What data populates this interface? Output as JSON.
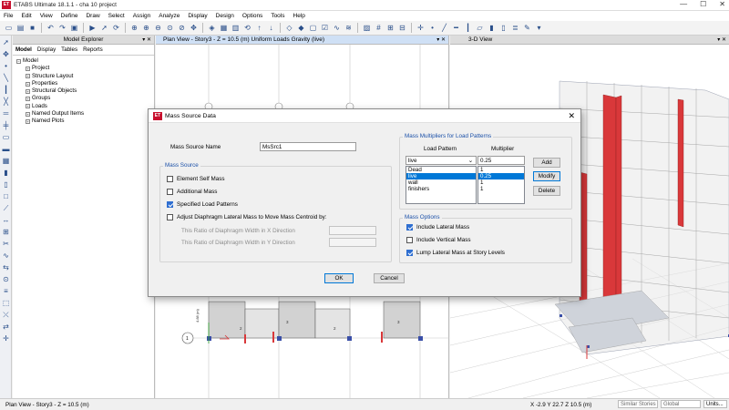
{
  "app": {
    "title": "ETABS Ultimate 18.1.1 - cha 10 project",
    "logo_text": "ET"
  },
  "window_controls": {
    "minimize": "—",
    "maximize": "☐",
    "close": "✕"
  },
  "menu": [
    "File",
    "Edit",
    "View",
    "Define",
    "Draw",
    "Select",
    "Assign",
    "Analyze",
    "Display",
    "Design",
    "Options",
    "Tools",
    "Help"
  ],
  "explorer": {
    "title": "Model Explorer",
    "tabs": [
      "Model",
      "Display",
      "Tables",
      "Reports"
    ],
    "root": "Model",
    "items": [
      "Project",
      "Structure Layout",
      "Properties",
      "Structural Objects",
      "Groups",
      "Loads",
      "Named Output Items",
      "Named Plots"
    ]
  },
  "plan_view": {
    "title": "Plan View - Story3 - Z = 10.5 (m)  Uniform Loads Gravity  (live)",
    "grid_number": "1",
    "dimension_label": "4.88 (m)",
    "area_labels": [
      "2",
      "3",
      "2",
      "3"
    ]
  },
  "view_3d": {
    "title": "3-D View"
  },
  "status": {
    "left": "Plan View - Story3 - Z = 10.5 (m)",
    "coords": "X -2.9  Y 22.7  Z 10.5 (m)",
    "stories": "Similar Stories",
    "coord_system": "Global",
    "units": "Units..."
  },
  "dialog": {
    "title": "Mass Source Data",
    "logo_text": "ET",
    "close": "✕",
    "mass_source_name_label": "Mass Source Name",
    "mass_source_name": "MsSrc1",
    "mass_source_group": "Mass Source",
    "element_self_mass": "Element Self Mass",
    "additional_mass": "Additional Mass",
    "specified_load_patterns": "Specified Load Patterns",
    "adjust_diaphragm": "Adjust Diaphragm Lateral Mass to Move Mass Centroid by:",
    "ratio_x": "This Ratio of Diaphragm Width in X Direction",
    "ratio_y": "This Ratio of Diaphragm Width in Y Direction",
    "multipliers_group": "Mass Multipliers for Load Patterns",
    "col_load_pattern": "Load Pattern",
    "col_multiplier": "Multiplier",
    "current_pattern": "live",
    "current_multiplier": "0.25",
    "patterns": [
      {
        "name": "Dead",
        "mult": "1"
      },
      {
        "name": "live",
        "mult": "0.25"
      },
      {
        "name": "wall",
        "mult": "1"
      },
      {
        "name": "finishers",
        "mult": "1"
      }
    ],
    "add": "Add",
    "modify": "Modify",
    "delete": "Delete",
    "mass_options_group": "Mass Options",
    "include_lateral": "Include Lateral Mass",
    "include_vertical": "Include Vertical Mass",
    "lump_lateral": "Lump Lateral Mass at Story Levels",
    "ok": "OK",
    "cancel": "Cancel"
  },
  "colors": {
    "accent": "#0078d7",
    "group_title": "#1b50a8",
    "column_red": "#d9383a",
    "logo_red": "#c8102e"
  }
}
